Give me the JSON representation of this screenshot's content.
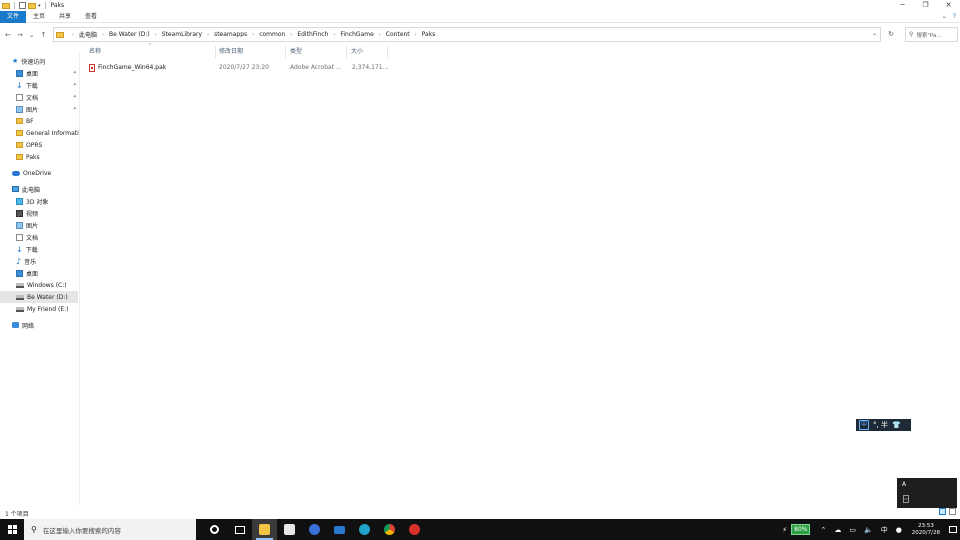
{
  "window": {
    "title": "Paks"
  },
  "ribbon": {
    "tabs": [
      "文件",
      "主页",
      "共享",
      "查看"
    ]
  },
  "address": {
    "crumbs": [
      "此电脑",
      "Be Water (D:)",
      "SteamLibrary",
      "steamapps",
      "common",
      "EdithFinch",
      "FinchGame",
      "Content",
      "Paks"
    ],
    "search_placeholder": "搜索\"Pa..."
  },
  "navpane": {
    "quick_access": "快速访问",
    "quick_items": [
      "桌面",
      "下载",
      "文档",
      "图片",
      "BF",
      "General Informati",
      "OPRS",
      "Paks"
    ],
    "onedrive": "OneDrive",
    "this_pc": "此电脑",
    "pc_items": [
      "3D 对象",
      "视频",
      "图片",
      "文档",
      "下载",
      "音乐",
      "桌面",
      "Windows (C:)",
      "Be Water (D:)",
      "My Friend (E:)"
    ],
    "network": "网络"
  },
  "filelist": {
    "columns": [
      "名称",
      "修改日期",
      "类型",
      "大小"
    ],
    "rows": [
      {
        "name": "FinchGame_Win64.pak",
        "date": "2020/7/27 23:20",
        "type": "Adobe Acrobat ...",
        "size": "2,374,171..."
      }
    ]
  },
  "status": {
    "item_count": "1 个项目"
  },
  "ime": {
    "mode": "中",
    "extra": "°, 半"
  },
  "popup": {
    "text": "A"
  },
  "taskbar": {
    "search_placeholder": "在这里输入你要搜索的内容",
    "battery": "80%",
    "lang": "中",
    "time": "23:53",
    "date": "2020/7/28"
  }
}
